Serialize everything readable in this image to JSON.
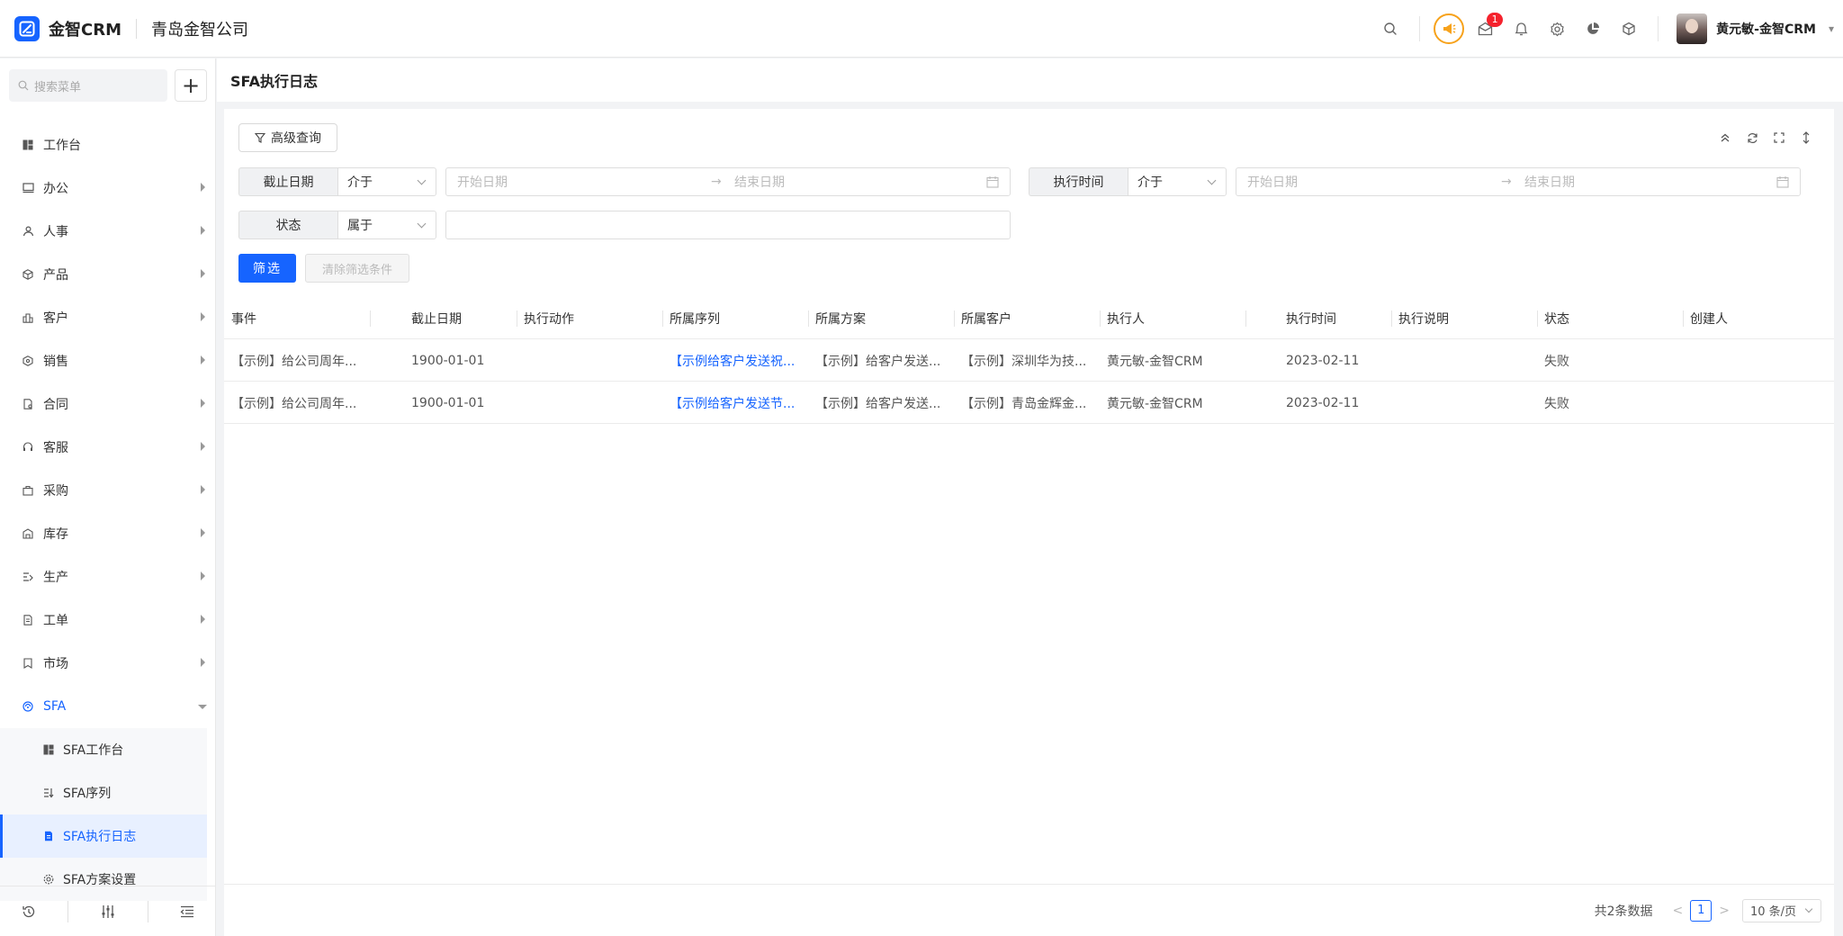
{
  "header": {
    "brand": "金智CRM",
    "company": "青岛金智公司",
    "notification_count": "1",
    "user_name": "黄元敏-金智CRM"
  },
  "sidebar": {
    "search_placeholder": "搜索菜单",
    "add_label": "+",
    "items": [
      {
        "label": "工作台",
        "icon": "dashboard-icon"
      },
      {
        "label": "办公",
        "icon": "monitor-icon"
      },
      {
        "label": "人事",
        "icon": "people-icon"
      },
      {
        "label": "产品",
        "icon": "cube-icon"
      },
      {
        "label": "客户",
        "icon": "customer-icon"
      },
      {
        "label": "销售",
        "icon": "sales-icon"
      },
      {
        "label": "合同",
        "icon": "contract-icon"
      },
      {
        "label": "客服",
        "icon": "headset-icon"
      },
      {
        "label": "采购",
        "icon": "purchase-icon"
      },
      {
        "label": "库存",
        "icon": "warehouse-icon"
      },
      {
        "label": "生产",
        "icon": "production-icon"
      },
      {
        "label": "工单",
        "icon": "ticket-icon"
      },
      {
        "label": "市场",
        "icon": "market-icon"
      },
      {
        "label": "SFA",
        "icon": "sfa-icon"
      }
    ],
    "sfa_sub": [
      {
        "label": "SFA工作台",
        "icon": "dashboard-icon"
      },
      {
        "label": "SFA序列",
        "icon": "sequence-icon"
      },
      {
        "label": "SFA执行日志",
        "icon": "log-icon"
      },
      {
        "label": "SFA方案设置",
        "icon": "settings-icon"
      }
    ]
  },
  "page": {
    "title": "SFA执行日志"
  },
  "filters": {
    "advanced_label": "高级查询",
    "deadline_label": "截止日期",
    "deadline_op": "介于",
    "exec_time_label": "执行时间",
    "exec_time_op": "介于",
    "status_label": "状态",
    "status_op": "属于",
    "start_placeholder": "开始日期",
    "end_placeholder": "结束日期",
    "arrow": "→",
    "filter_btn": "筛选",
    "clear_btn": "清除筛选条件"
  },
  "table": {
    "columns": [
      "事件",
      "截止日期",
      "执行动作",
      "所属序列",
      "所属方案",
      "所属客户",
      "执行人",
      "执行时间",
      "执行说明",
      "状态",
      "创建人"
    ],
    "rows": [
      [
        "【示例】给公司周年...",
        "1900-01-01",
        "",
        "【示例给客户发送祝...",
        "【示例】给客户发送...",
        "【示例】深圳华为技...",
        "黄元敏-金智CRM",
        "2023-02-11",
        "",
        "失败",
        ""
      ],
      [
        "【示例】给公司周年...",
        "1900-01-01",
        "",
        "【示例给客户发送节...",
        "【示例】给客户发送...",
        "【示例】青岛金辉金...",
        "黄元敏-金智CRM",
        "2023-02-11",
        "",
        "失败",
        ""
      ]
    ]
  },
  "pager": {
    "total": "共2条数据",
    "prev": "<",
    "page": "1",
    "next": ">",
    "page_size": "10 条/页"
  },
  "colors": {
    "primary": "#1664ff",
    "horn": "#f7a21b",
    "badge": "#f5222d"
  }
}
